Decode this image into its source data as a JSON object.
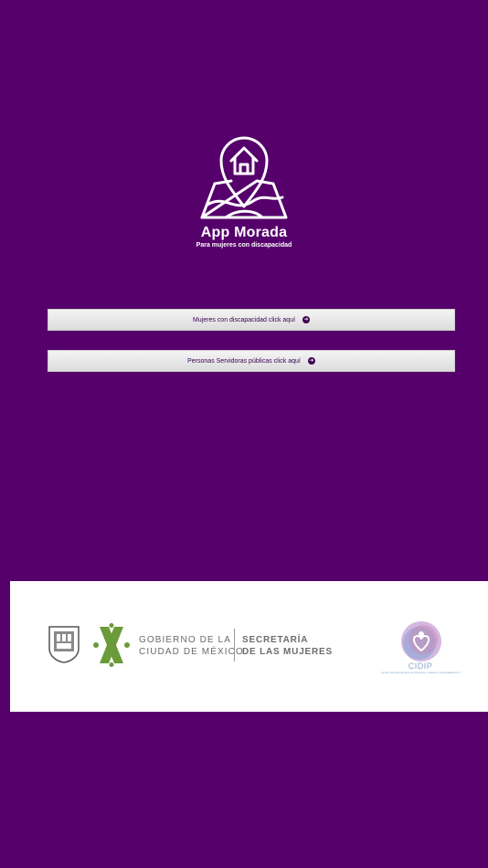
{
  "app": {
    "title": "App Morada",
    "subtitle": "Para mujeres con  discapacidad"
  },
  "buttons": [
    {
      "label": "Mujeres con discapacidad click aquí",
      "icon": "arrow-right-circle-icon"
    },
    {
      "label": "Personas Servidoras públicas click aquí",
      "icon": "arrow-right-circle-icon"
    }
  ],
  "footer": {
    "gov_line1": "GOBIERNO DE LA",
    "gov_line2": "CIUDAD DE MÉXICO",
    "sec_line1": "SECRETARÍA",
    "sec_line2": "DE LAS MUJERES",
    "cidip_name": "CIDIP",
    "cidip_sub": "Centro Interdisciplinario de Derechos, Infancia y Parentalidad A.C."
  },
  "colors": {
    "background": "#56006c",
    "button_text": "#3a0050",
    "cdmx_green": "#6a9a3a",
    "gray_text": "#6b6b6b"
  }
}
